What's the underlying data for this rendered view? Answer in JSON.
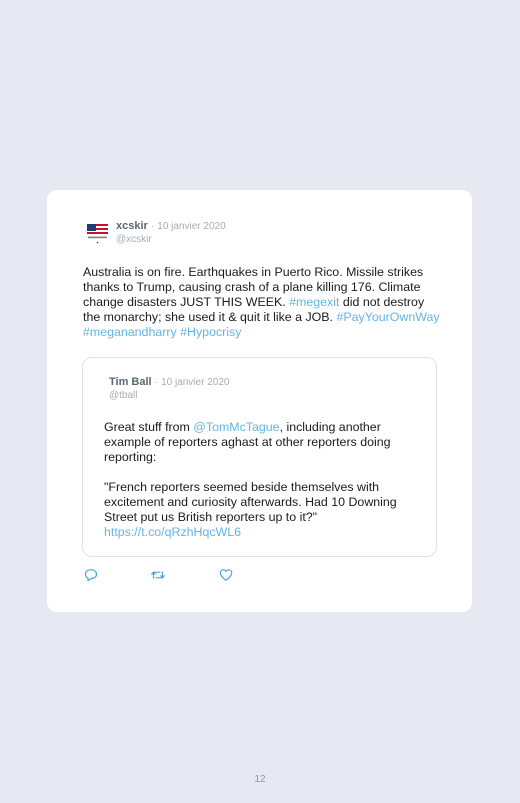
{
  "tweet": {
    "author_name": "xcskir",
    "date": "10 janvier 2020",
    "handle": "@xcskir",
    "text_segments": [
      {
        "t": "Australia is on fire. Earthquakes in Puerto Rico. Missile strikes thanks to Trump, causing crash of a plane killing 176. Climate change disasters JUST THIS WEEK. ",
        "link": false
      },
      {
        "t": "#megexit",
        "link": true
      },
      {
        "t": " did not destroy the monarchy; she used it & quit it like a JOB. ",
        "link": false
      },
      {
        "t": "#PayYourOwnWay",
        "link": true
      },
      {
        "t": " ",
        "link": false
      },
      {
        "t": "#meganandharry",
        "link": true
      },
      {
        "t": " ",
        "link": false
      },
      {
        "t": "#Hypocrisy",
        "link": true
      }
    ]
  },
  "quoted": {
    "author_name": "Tim Ball",
    "date": "10 janvier 2020",
    "handle": "@tball",
    "para1": [
      {
        "t": "Great stuff from ",
        "link": false
      },
      {
        "t": "@TomMcTague",
        "link": true
      },
      {
        "t": ", including another example of reporters aghast at other reporters doing reporting:",
        "link": false
      }
    ],
    "para2": [
      {
        "t": "\"French reporters seemed beside themselves with excitement and curiosity afterwards. Had 10 Downing Street put us British reporters up to it?\" ",
        "link": false
      },
      {
        "t": "https://t.co/qRzhHqcWL6",
        "link": true
      }
    ]
  },
  "actions": {
    "reply_icon": "reply-icon",
    "retweet_icon": "retweet-icon",
    "like_icon": "heart-icon"
  },
  "page_number": "12",
  "colors": {
    "background": "#e6e9f1",
    "card": "#ffffff",
    "link": "#64b5e3",
    "meta": "#a6adb4"
  }
}
